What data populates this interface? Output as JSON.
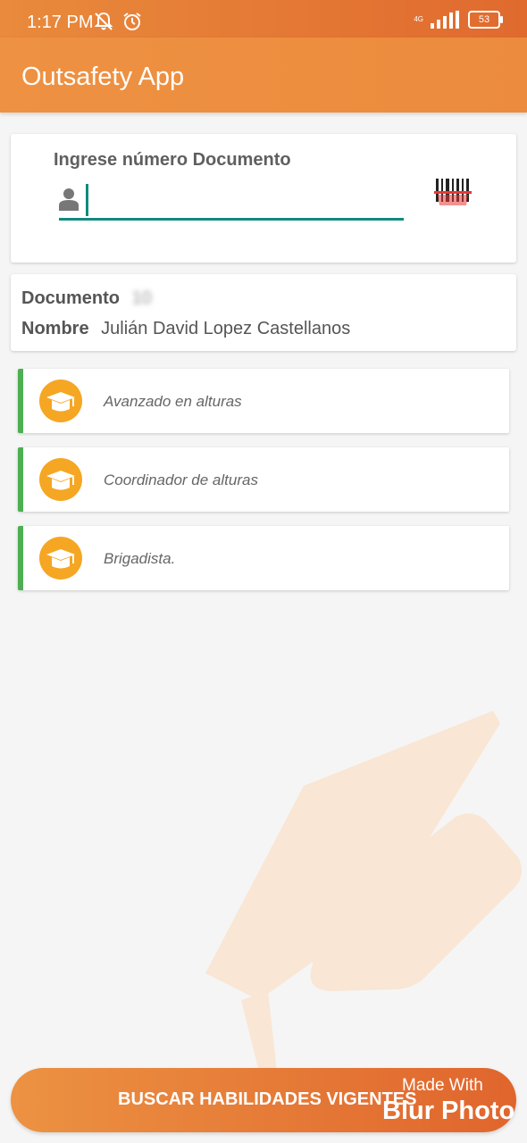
{
  "status_bar": {
    "time": "1:17 PM",
    "network": "4G",
    "battery": "53",
    "icons": [
      "mute-alert-icon",
      "alarm-icon",
      "signal-icon",
      "battery-icon"
    ]
  },
  "app_bar": {
    "title": "Outsafety App"
  },
  "document_input": {
    "label": "Ingrese número Documento",
    "value": "",
    "placeholder": ""
  },
  "person": {
    "document_label": "Documento",
    "document_value": "10",
    "name_label": "Nombre",
    "name_value": "Julián David Lopez Castellanos"
  },
  "skills": [
    {
      "label": "Avanzado en alturas"
    },
    {
      "label": "Coordinador de alturas"
    },
    {
      "label": "Brigadista."
    }
  ],
  "search_button": {
    "label": "BUSCAR HABILIDADES VIGENTES"
  },
  "overlay": {
    "made_with": "Made With",
    "brand": "Blur Photo"
  },
  "colors": {
    "primary": "#ec8b3d",
    "accent_teal": "#0f8b7e",
    "success_bar": "#4caf50",
    "icon_yellow": "#f5a623"
  }
}
